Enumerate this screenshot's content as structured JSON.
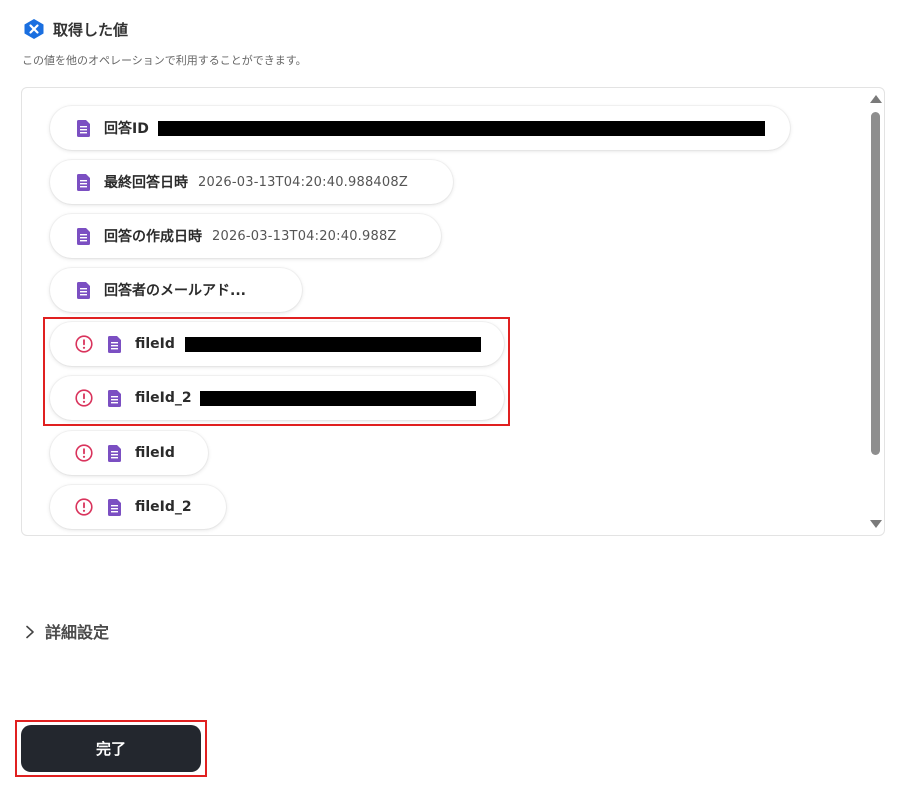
{
  "header": {
    "title": "取得した値",
    "icon": "yoom-x-icon",
    "icon_color": "#1a6fe0"
  },
  "subtitle": "この値を他のオペレーションで利用することができます。",
  "colors": {
    "doc_icon": "#7b4fc2",
    "warn_icon": "#d9335c",
    "highlight": "#e02020",
    "button_bg": "#23272e"
  },
  "outputs": [
    {
      "label": "回答ID",
      "value": "",
      "redacted": true,
      "warning": false
    },
    {
      "label": "最終回答日時",
      "value": "2026-03-13T04:20:40.988408Z",
      "redacted": false,
      "warning": false
    },
    {
      "label": "回答の作成日時",
      "value": "2026-03-13T04:20:40.988Z",
      "redacted": false,
      "warning": false
    },
    {
      "label": "回答者のメールアド...",
      "value": "",
      "redacted": false,
      "warning": false
    },
    {
      "label": "fileId",
      "value": "",
      "redacted": true,
      "warning": true
    },
    {
      "label": "fileId_2",
      "value": "",
      "redacted": true,
      "warning": true
    },
    {
      "label": "fileId",
      "value": "",
      "redacted": false,
      "warning": true
    },
    {
      "label": "fileId_2",
      "value": "",
      "redacted": false,
      "warning": true
    }
  ],
  "advanced": {
    "label": "詳細設定"
  },
  "done_button": {
    "label": "完了"
  }
}
